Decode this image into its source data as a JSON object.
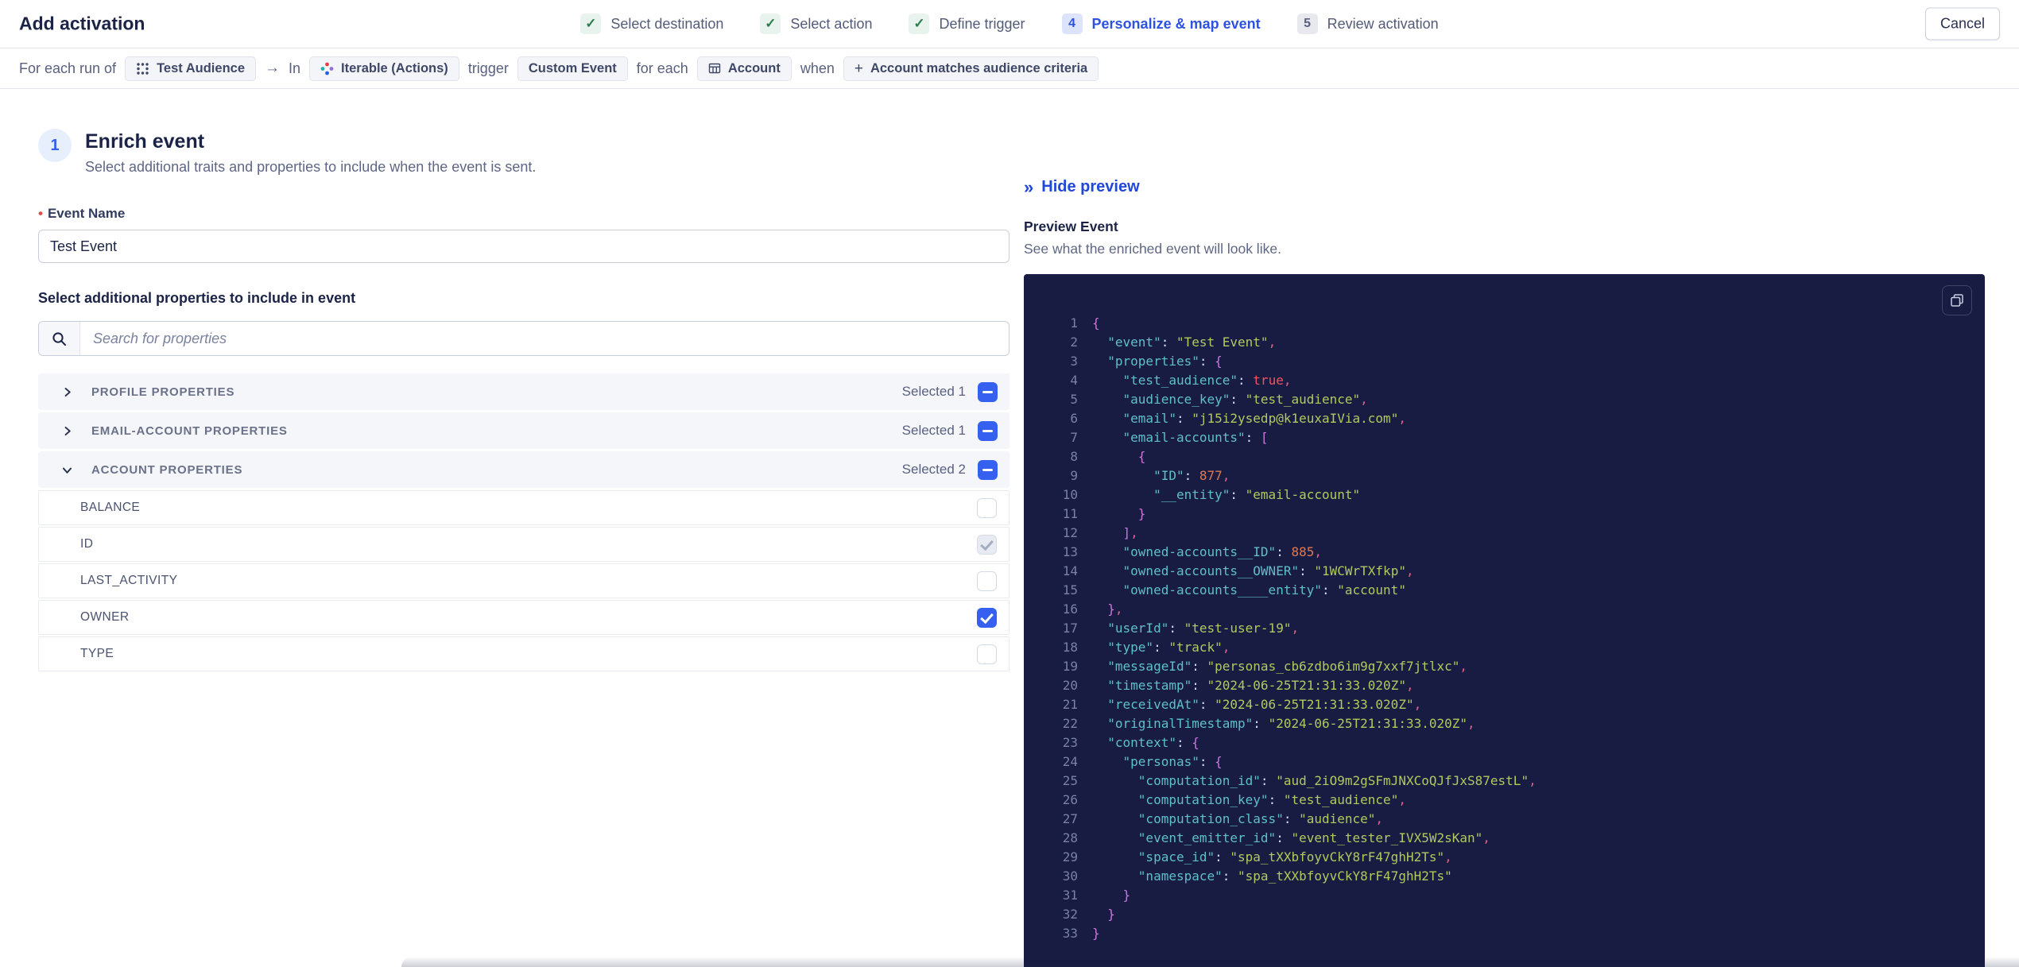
{
  "header": {
    "title": "Add activation",
    "check_glyph": "✓",
    "steps": [
      {
        "label": "Select destination",
        "state": "done"
      },
      {
        "label": "Select action",
        "state": "done"
      },
      {
        "label": "Define trigger",
        "state": "done"
      },
      {
        "label": "Personalize & map event",
        "state": "active",
        "number": "4"
      },
      {
        "label": "Review activation",
        "state": "upcoming",
        "number": "5"
      }
    ],
    "cancel_label": "Cancel"
  },
  "trigger_bar": {
    "prefix": "For each run of",
    "audience_chip": "Test Audience",
    "arrow": "→",
    "in_label": "In",
    "destination_chip": "Iterable (Actions)",
    "trigger_label": "trigger",
    "event_chip": "Custom Event",
    "for_each_label": "for each",
    "entity_chip": "Account",
    "when_label": "when",
    "criteria_plus": "+",
    "criteria_chip": "Account matches audience criteria"
  },
  "enrich": {
    "step_number": "1",
    "title": "Enrich event",
    "subtitle": "Select additional traits and properties to include when the event is sent.",
    "event_name_label": "Event Name",
    "event_name_value": "Test Event",
    "properties_label": "Select additional properties to include in event",
    "search_placeholder": "Search for properties",
    "sections": [
      {
        "label": "PROFILE PROPERTIES",
        "selected_text": "Selected 1",
        "expanded": false
      },
      {
        "label": "EMAIL-ACCOUNT PROPERTIES",
        "selected_text": "Selected 1",
        "expanded": false
      },
      {
        "label": "ACCOUNT PROPERTIES",
        "selected_text": "Selected 2",
        "expanded": true
      }
    ],
    "account_properties": [
      {
        "label": "BALANCE",
        "checkbox": "unchecked"
      },
      {
        "label": "ID",
        "checkbox": "checked-disabled"
      },
      {
        "label": "LAST_ACTIVITY",
        "checkbox": "unchecked"
      },
      {
        "label": "OWNER",
        "checkbox": "checked"
      },
      {
        "label": "TYPE",
        "checkbox": "unchecked"
      }
    ]
  },
  "preview": {
    "hide_icon": "»",
    "hide_label": "Hide preview",
    "title": "Preview Event",
    "subtitle": "See what the enriched event will look like.",
    "code_lines": [
      {
        "num": "1",
        "tokens": [
          [
            "p",
            "{"
          ]
        ]
      },
      {
        "num": "2",
        "tokens": [
          [
            "k",
            "  \"event\""
          ],
          [
            "w",
            ": "
          ],
          [
            "s",
            "\"Test Event\""
          ],
          [
            "c",
            ","
          ]
        ]
      },
      {
        "num": "3",
        "tokens": [
          [
            "k",
            "  \"properties\""
          ],
          [
            "w",
            ": "
          ],
          [
            "p",
            "{"
          ]
        ]
      },
      {
        "num": "4",
        "tokens": [
          [
            "k",
            "    \"test_audience\""
          ],
          [
            "w",
            ": "
          ],
          [
            "b",
            "true"
          ],
          [
            "c",
            ","
          ]
        ]
      },
      {
        "num": "5",
        "tokens": [
          [
            "k",
            "    \"audience_key\""
          ],
          [
            "w",
            ": "
          ],
          [
            "s",
            "\"test_audience\""
          ],
          [
            "c",
            ","
          ]
        ]
      },
      {
        "num": "6",
        "tokens": [
          [
            "k",
            "    \"email\""
          ],
          [
            "w",
            ": "
          ],
          [
            "s",
            "\"j15i2ysedp@k1euxaIVia.com\""
          ],
          [
            "c",
            ","
          ]
        ]
      },
      {
        "num": "7",
        "tokens": [
          [
            "k",
            "    \"email-accounts\""
          ],
          [
            "w",
            ": "
          ],
          [
            "p",
            "["
          ]
        ]
      },
      {
        "num": "8",
        "tokens": [
          [
            "p",
            "      {"
          ]
        ]
      },
      {
        "num": "9",
        "tokens": [
          [
            "k",
            "        \"ID\""
          ],
          [
            "w",
            ": "
          ],
          [
            "n",
            "877"
          ],
          [
            "c",
            ","
          ]
        ]
      },
      {
        "num": "10",
        "tokens": [
          [
            "k",
            "        \"__entity\""
          ],
          [
            "w",
            ": "
          ],
          [
            "s",
            "\"email-account\""
          ]
        ]
      },
      {
        "num": "11",
        "tokens": [
          [
            "p",
            "      }"
          ]
        ]
      },
      {
        "num": "12",
        "tokens": [
          [
            "p",
            "    ]"
          ],
          [
            "c",
            ","
          ]
        ]
      },
      {
        "num": "13",
        "tokens": [
          [
            "k",
            "    \"owned-accounts__ID\""
          ],
          [
            "w",
            ": "
          ],
          [
            "n",
            "885"
          ],
          [
            "c",
            ","
          ]
        ]
      },
      {
        "num": "14",
        "tokens": [
          [
            "k",
            "    \"owned-accounts__OWNER\""
          ],
          [
            "w",
            ": "
          ],
          [
            "s",
            "\"1WCWrTXfkp\""
          ],
          [
            "c",
            ","
          ]
        ]
      },
      {
        "num": "15",
        "tokens": [
          [
            "k",
            "    \"owned-accounts____entity\""
          ],
          [
            "w",
            ": "
          ],
          [
            "s",
            "\"account\""
          ]
        ]
      },
      {
        "num": "16",
        "tokens": [
          [
            "p",
            "  }"
          ],
          [
            "c",
            ","
          ]
        ]
      },
      {
        "num": "17",
        "tokens": [
          [
            "k",
            "  \"userId\""
          ],
          [
            "w",
            ": "
          ],
          [
            "s",
            "\"test-user-19\""
          ],
          [
            "c",
            ","
          ]
        ]
      },
      {
        "num": "18",
        "tokens": [
          [
            "k",
            "  \"type\""
          ],
          [
            "w",
            ": "
          ],
          [
            "s",
            "\"track\""
          ],
          [
            "c",
            ","
          ]
        ]
      },
      {
        "num": "19",
        "tokens": [
          [
            "k",
            "  \"messageId\""
          ],
          [
            "w",
            ": "
          ],
          [
            "s",
            "\"personas_cb6zdbo6im9g7xxf7jtlxc\""
          ],
          [
            "c",
            ","
          ]
        ]
      },
      {
        "num": "20",
        "tokens": [
          [
            "k",
            "  \"timestamp\""
          ],
          [
            "w",
            ": "
          ],
          [
            "s",
            "\"2024-06-25T21:31:33.020Z\""
          ],
          [
            "c",
            ","
          ]
        ]
      },
      {
        "num": "21",
        "tokens": [
          [
            "k",
            "  \"receivedAt\""
          ],
          [
            "w",
            ": "
          ],
          [
            "s",
            "\"2024-06-25T21:31:33.020Z\""
          ],
          [
            "c",
            ","
          ]
        ]
      },
      {
        "num": "22",
        "tokens": [
          [
            "k",
            "  \"originalTimestamp\""
          ],
          [
            "w",
            ": "
          ],
          [
            "s",
            "\"2024-06-25T21:31:33.020Z\""
          ],
          [
            "c",
            ","
          ]
        ]
      },
      {
        "num": "23",
        "tokens": [
          [
            "k",
            "  \"context\""
          ],
          [
            "w",
            ": "
          ],
          [
            "p",
            "{"
          ]
        ]
      },
      {
        "num": "24",
        "tokens": [
          [
            "k",
            "    \"personas\""
          ],
          [
            "w",
            ": "
          ],
          [
            "p",
            "{"
          ]
        ]
      },
      {
        "num": "25",
        "tokens": [
          [
            "k",
            "      \"computation_id\""
          ],
          [
            "w",
            ": "
          ],
          [
            "s",
            "\"aud_2iO9m2gSFmJNXCoQJfJxS87estL\""
          ],
          [
            "c",
            ","
          ]
        ]
      },
      {
        "num": "26",
        "tokens": [
          [
            "k",
            "      \"computation_key\""
          ],
          [
            "w",
            ": "
          ],
          [
            "s",
            "\"test_audience\""
          ],
          [
            "c",
            ","
          ]
        ]
      },
      {
        "num": "27",
        "tokens": [
          [
            "k",
            "      \"computation_class\""
          ],
          [
            "w",
            ": "
          ],
          [
            "s",
            "\"audience\""
          ],
          [
            "c",
            ","
          ]
        ]
      },
      {
        "num": "28",
        "tokens": [
          [
            "k",
            "      \"event_emitter_id\""
          ],
          [
            "w",
            ": "
          ],
          [
            "s",
            "\"event_tester_IVX5W2sKan\""
          ],
          [
            "c",
            ","
          ]
        ]
      },
      {
        "num": "29",
        "tokens": [
          [
            "k",
            "      \"space_id\""
          ],
          [
            "w",
            ": "
          ],
          [
            "s",
            "\"spa_tXXbfoyvCkY8rF47ghH2Ts\""
          ],
          [
            "c",
            ","
          ]
        ]
      },
      {
        "num": "30",
        "tokens": [
          [
            "k",
            "      \"namespace\""
          ],
          [
            "w",
            ": "
          ],
          [
            "s",
            "\"spa_tXXbfoyvCkY8rF47ghH2Ts\""
          ]
        ]
      },
      {
        "num": "31",
        "tokens": [
          [
            "p",
            "    }"
          ]
        ]
      },
      {
        "num": "32",
        "tokens": [
          [
            "p",
            "  }"
          ]
        ]
      },
      {
        "num": "33",
        "tokens": [
          [
            "p",
            "}"
          ]
        ]
      }
    ]
  },
  "colors": {
    "accent_blue": "#3661F0",
    "link_blue": "#2148D6",
    "active_step_blue": "#2C53E0",
    "done_green": "#2E7D4F",
    "code_bg": "#181C42",
    "code_key": "#5FBFC9",
    "code_string": "#B1C95E",
    "code_number": "#E0784E",
    "code_boolean": "#F25263",
    "code_bracket": "#C678DD"
  }
}
